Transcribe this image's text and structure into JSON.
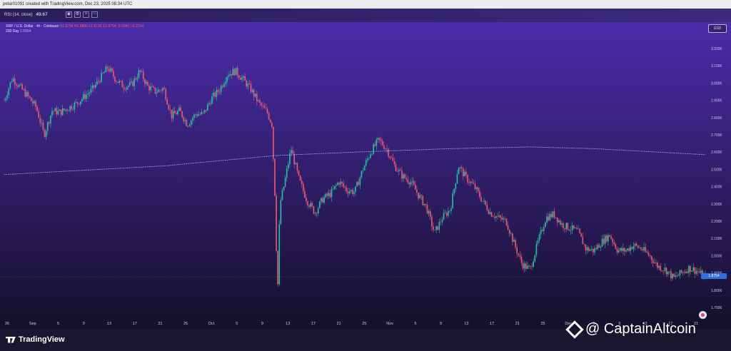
{
  "header": {
    "creator": "petar01091 created with TradingView.com, Dec 23, 2025 08:34 UTC"
  },
  "rsi": {
    "label": "RSI (14, close)",
    "value": "49.67"
  },
  "legend": {
    "symbol": "XRP / U.S. Dollar · 4h · Coinbase",
    "ohlc": "O1.8794 H1.8896 L1.8733 C1.8754 -0.0040 (-0.21%)",
    "sma": "200 Day",
    "sma_value": "2.5864"
  },
  "axis": {
    "currency": "USD",
    "last_price": "1.8754"
  },
  "watermark": {
    "brand": "@ CaptainAltcoin",
    "logo_text": "TradingView"
  },
  "colors": {
    "up": "#22c7a0",
    "down": "#f05a6e",
    "sma": "#8fb0ff",
    "bg_top": "#4b2cab",
    "bg_bottom": "#15102a"
  },
  "chart_data": {
    "type": "candlestick",
    "timeframe": "4h",
    "ylim": [
      1.65,
      3.3
    ],
    "ytick_labels": [
      "3.2000",
      "3.1000",
      "3.0000",
      "2.9000",
      "2.8000",
      "2.7000",
      "2.6000",
      "2.5000",
      "2.4000",
      "2.3000",
      "2.2000",
      "2.1000",
      "2.0000",
      "1.9000",
      "1.8000",
      "1.7000"
    ],
    "xtick_labels": [
      "26",
      "Sep",
      "5",
      "9",
      "13",
      "17",
      "21",
      "25",
      "Oct",
      "5",
      "9",
      "13",
      "17",
      "21",
      "25",
      "Nov",
      "5",
      "9",
      "13",
      "17",
      "21",
      "25",
      "Dec",
      "5",
      "9",
      "13",
      "17",
      "21"
    ],
    "price_path": [
      [
        0,
        2.9
      ],
      [
        1,
        3.03
      ],
      [
        3,
        2.92
      ],
      [
        4,
        2.86
      ],
      [
        5,
        2.7
      ],
      [
        6,
        2.84
      ],
      [
        7,
        2.83
      ],
      [
        9,
        2.88
      ],
      [
        11,
        2.96
      ],
      [
        13,
        3.09
      ],
      [
        14,
        3.02
      ],
      [
        15,
        2.98
      ],
      [
        16,
        2.99
      ],
      [
        17,
        3.07
      ],
      [
        18,
        2.98
      ],
      [
        19,
        2.95
      ],
      [
        20,
        2.97
      ],
      [
        21,
        2.81
      ],
      [
        22,
        2.84
      ],
      [
        23,
        2.76
      ],
      [
        24,
        2.82
      ],
      [
        25,
        2.82
      ],
      [
        26,
        2.91
      ],
      [
        27,
        2.96
      ],
      [
        28,
        3.05
      ],
      [
        29,
        3.07
      ],
      [
        30,
        3.02
      ],
      [
        31,
        2.96
      ],
      [
        32,
        2.88
      ],
      [
        33,
        2.83
      ],
      [
        33.6,
        2.76
      ],
      [
        34,
        2.32
      ],
      [
        34.3,
        1.77
      ],
      [
        34.6,
        2.3
      ],
      [
        35,
        2.38
      ],
      [
        36,
        2.62
      ],
      [
        37,
        2.44
      ],
      [
        38,
        2.32
      ],
      [
        39,
        2.25
      ],
      [
        40,
        2.33
      ],
      [
        41,
        2.36
      ],
      [
        42,
        2.43
      ],
      [
        43,
        2.38
      ],
      [
        44,
        2.37
      ],
      [
        45,
        2.5
      ],
      [
        46,
        2.6
      ],
      [
        47,
        2.67
      ],
      [
        48,
        2.62
      ],
      [
        49,
        2.52
      ],
      [
        50,
        2.46
      ],
      [
        51,
        2.43
      ],
      [
        52,
        2.35
      ],
      [
        53,
        2.28
      ],
      [
        54,
        2.13
      ],
      [
        55,
        2.22
      ],
      [
        56,
        2.27
      ],
      [
        57,
        2.52
      ],
      [
        58,
        2.45
      ],
      [
        59,
        2.4
      ],
      [
        60,
        2.32
      ],
      [
        61,
        2.25
      ],
      [
        62,
        2.22
      ],
      [
        63,
        2.2
      ],
      [
        64,
        2.07
      ],
      [
        65,
        1.95
      ],
      [
        66,
        1.92
      ],
      [
        67,
        2.08
      ],
      [
        68,
        2.22
      ],
      [
        69,
        2.24
      ],
      [
        70,
        2.18
      ],
      [
        71,
        2.16
      ],
      [
        72,
        2.14
      ],
      [
        73,
        2.04
      ],
      [
        74,
        2.03
      ],
      [
        75,
        2.08
      ],
      [
        76,
        2.12
      ],
      [
        77,
        2.03
      ],
      [
        78,
        2.03
      ],
      [
        79,
        2.06
      ],
      [
        80,
        2.04
      ],
      [
        81,
        2.0
      ],
      [
        82,
        1.94
      ],
      [
        83,
        1.92
      ],
      [
        84,
        1.87
      ],
      [
        85,
        1.9
      ],
      [
        86,
        1.93
      ],
      [
        87,
        1.91
      ],
      [
        88,
        1.875
      ]
    ],
    "sma_200_path": [
      [
        0,
        2.47
      ],
      [
        20,
        2.52
      ],
      [
        34,
        2.58
      ],
      [
        44,
        2.6
      ],
      [
        56,
        2.62
      ],
      [
        66,
        2.63
      ],
      [
        74,
        2.62
      ],
      [
        88,
        2.585
      ]
    ]
  }
}
